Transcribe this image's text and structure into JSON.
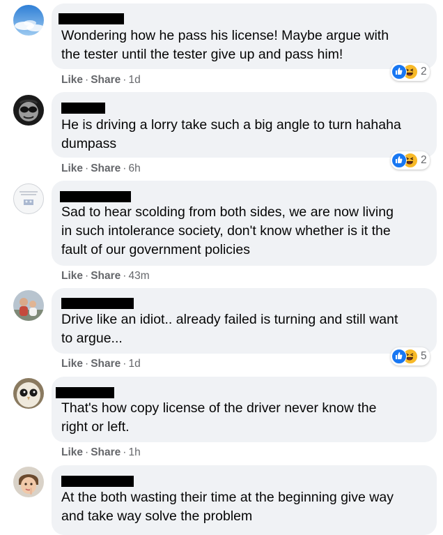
{
  "comments": [
    {
      "lines": [
        "Wondering how he pass his license! Maybe argue with",
        "the tester until the tester give up and pass him!"
      ],
      "like_label": "Like",
      "share_label": "Share",
      "time": "1d",
      "reaction_count": "2",
      "avatar_icon": "sky-avatar-icon"
    },
    {
      "lines": [
        "He is driving a lorry take such a big angle to turn hahaha",
        "dumpass"
      ],
      "like_label": "Like",
      "share_label": "Share",
      "time": "6h",
      "reaction_count": "2",
      "avatar_icon": "sunglasses-avatar-icon"
    },
    {
      "lines": [
        "Sad to hear scolding from both sides, we are now living",
        "in such intolerance society, don't know whether is it the",
        "fault of our government policies"
      ],
      "like_label": "Like",
      "share_label": "Share",
      "time": "43m",
      "avatar_icon": "default-avatar-icon"
    },
    {
      "lines": [
        "Drive like an idiot.. already failed is turning and still want",
        "to argue..."
      ],
      "like_label": "Like",
      "share_label": "Share",
      "time": "1d",
      "reaction_count": "5",
      "avatar_icon": "people-avatar-icon"
    },
    {
      "lines": [
        "That's how copy license of the driver never know the",
        "right or left."
      ],
      "like_label": "Like",
      "share_label": "Share",
      "time": "1h",
      "avatar_icon": "owl-avatar-icon"
    },
    {
      "lines": [
        "At the both wasting their time at the beginning give way",
        "and take way solve the problem"
      ],
      "avatar_icon": "child-avatar-icon"
    }
  ],
  "separator": "·",
  "colors": {
    "bubble": "#f0f2f5",
    "meta_text": "#65676b",
    "like_blue": "#1877f2",
    "haha_yellow": "#f7b928"
  }
}
